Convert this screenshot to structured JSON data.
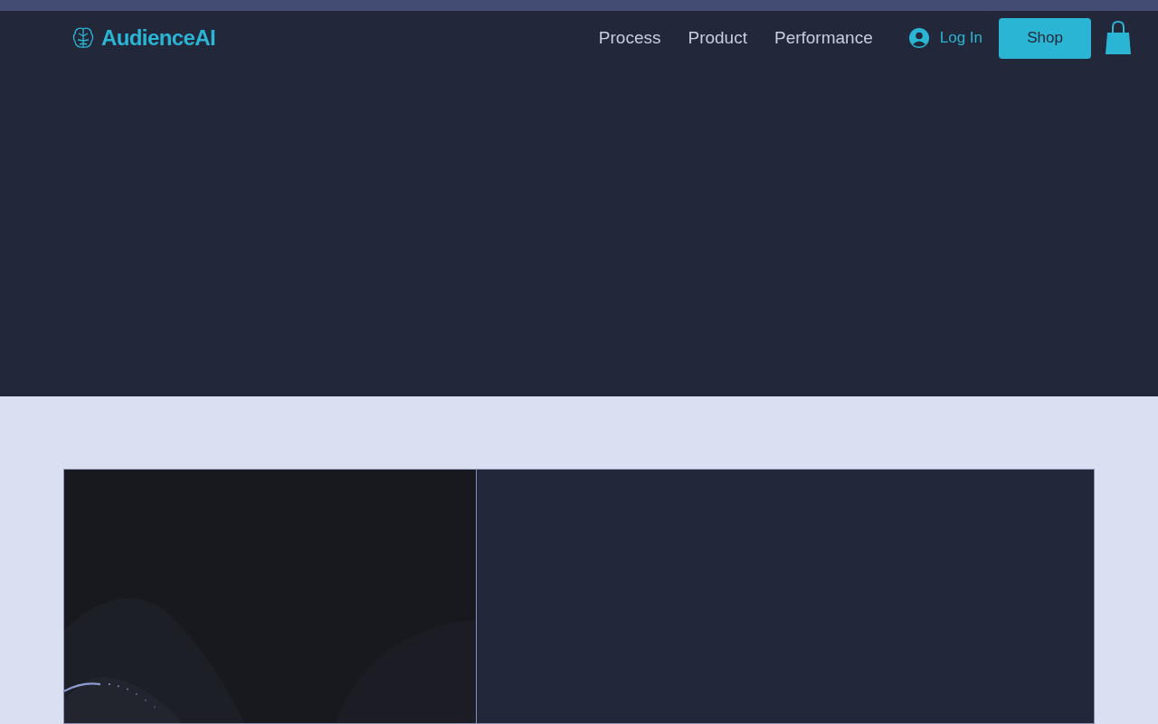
{
  "header": {
    "logo": "AudienceAI",
    "nav": [
      {
        "label": "Process"
      },
      {
        "label": "Product"
      },
      {
        "label": "Performance"
      }
    ],
    "login": "Log In",
    "shop_button": "Shop"
  }
}
